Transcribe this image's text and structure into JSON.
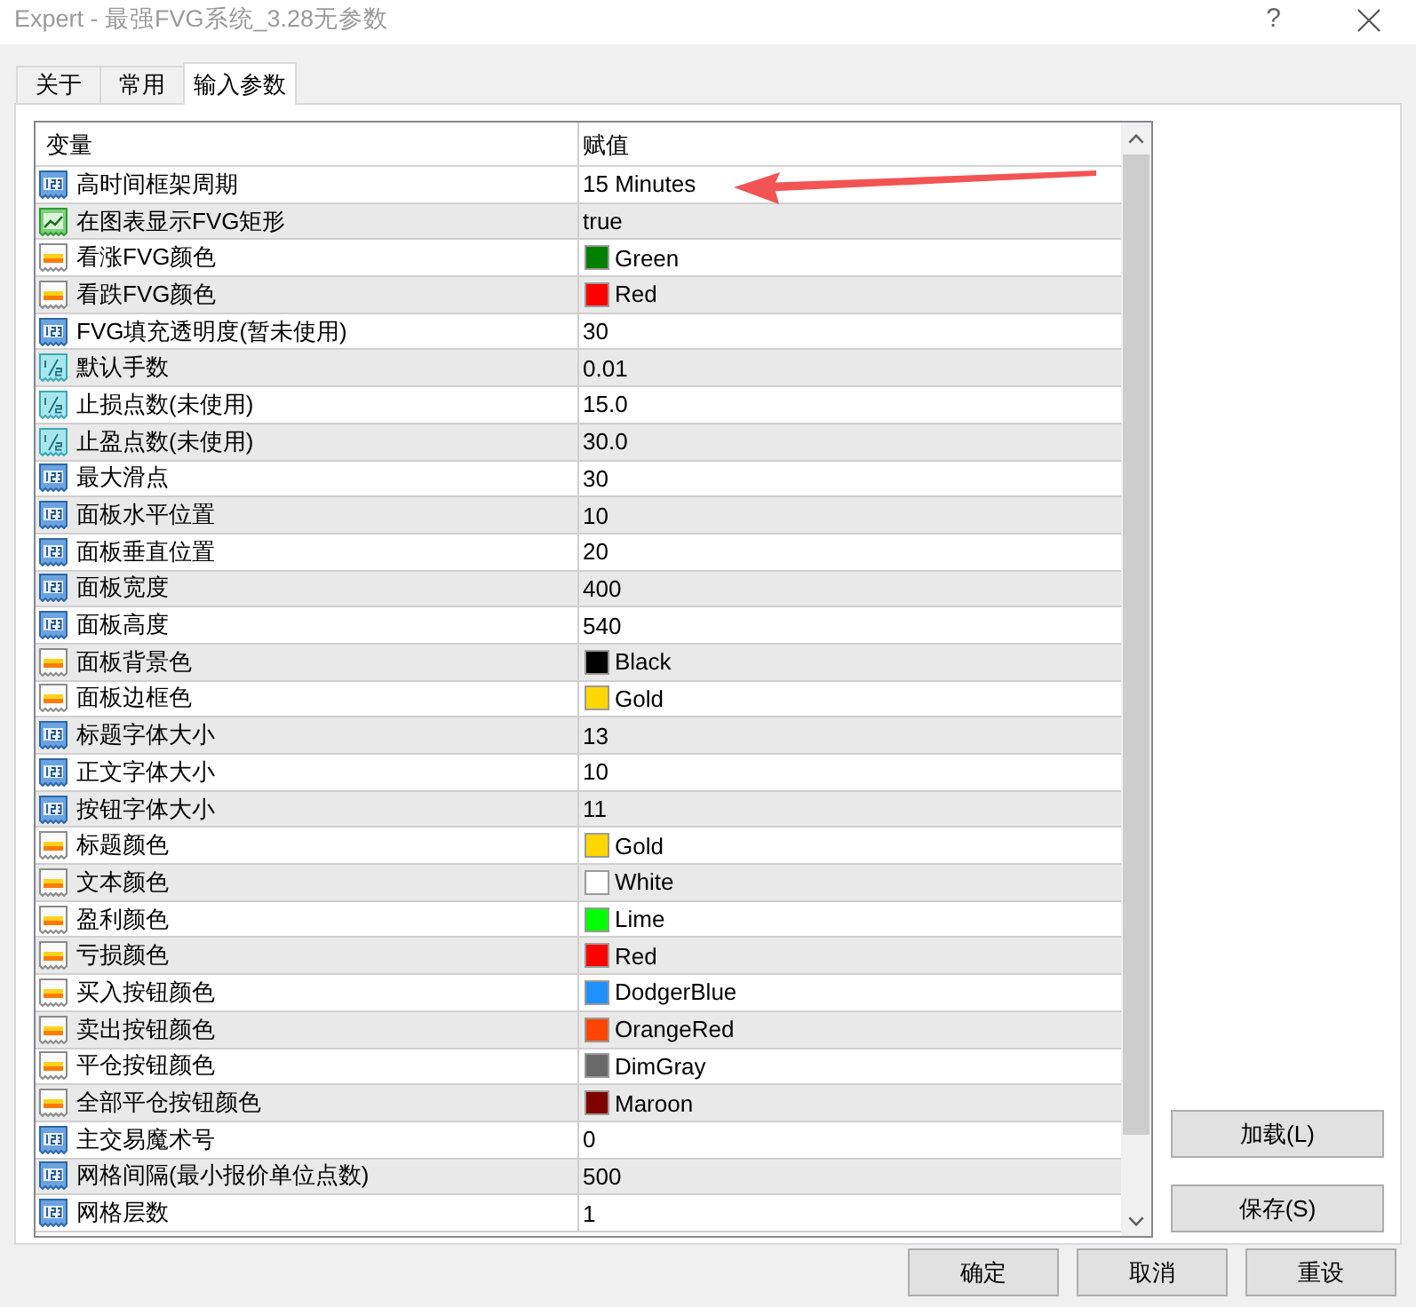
{
  "window": {
    "title": "Expert - 最强FVG系统_3.28无参数",
    "help": "?"
  },
  "tabs": [
    {
      "label": "关于",
      "selected": false
    },
    {
      "label": "常用",
      "selected": false
    },
    {
      "label": "输入参数",
      "selected": true
    }
  ],
  "table": {
    "columns": [
      "变量",
      "赋值"
    ],
    "rows": [
      {
        "kind": "int",
        "name": "高时间框架周期",
        "value": "15 Minutes"
      },
      {
        "kind": "bool",
        "name": "在图表显示FVG矩形",
        "value": "true"
      },
      {
        "kind": "color",
        "name": "看涨FVG颜色",
        "value": "Green",
        "color": "#008000"
      },
      {
        "kind": "color",
        "name": "看跌FVG颜色",
        "value": "Red",
        "color": "#ff0000"
      },
      {
        "kind": "int",
        "name": "FVG填充透明度(暂未使用)",
        "value": "30"
      },
      {
        "kind": "double",
        "name": "默认手数",
        "value": "0.01"
      },
      {
        "kind": "double",
        "name": "止损点数(未使用)",
        "value": "15.0"
      },
      {
        "kind": "double",
        "name": "止盈点数(未使用)",
        "value": "30.0"
      },
      {
        "kind": "int",
        "name": "最大滑点",
        "value": "30"
      },
      {
        "kind": "int",
        "name": "面板水平位置",
        "value": "10"
      },
      {
        "kind": "int",
        "name": "面板垂直位置",
        "value": "20"
      },
      {
        "kind": "int",
        "name": "面板宽度",
        "value": "400"
      },
      {
        "kind": "int",
        "name": "面板高度",
        "value": "540"
      },
      {
        "kind": "color",
        "name": "面板背景色",
        "value": "Black",
        "color": "#000000"
      },
      {
        "kind": "color",
        "name": "面板边框色",
        "value": "Gold",
        "color": "#ffd700"
      },
      {
        "kind": "int",
        "name": "标题字体大小",
        "value": "13"
      },
      {
        "kind": "int",
        "name": "正文字体大小",
        "value": "10"
      },
      {
        "kind": "int",
        "name": "按钮字体大小",
        "value": "11"
      },
      {
        "kind": "color",
        "name": "标题颜色",
        "value": "Gold",
        "color": "#ffd700"
      },
      {
        "kind": "color",
        "name": "文本颜色",
        "value": "White",
        "color": "#ffffff"
      },
      {
        "kind": "color",
        "name": "盈利颜色",
        "value": "Lime",
        "color": "#00ff00"
      },
      {
        "kind": "color",
        "name": "亏损颜色",
        "value": "Red",
        "color": "#ff0000"
      },
      {
        "kind": "color",
        "name": "买入按钮颜色",
        "value": "DodgerBlue",
        "color": "#1e90ff"
      },
      {
        "kind": "color",
        "name": "卖出按钮颜色",
        "value": "OrangeRed",
        "color": "#ff4500"
      },
      {
        "kind": "color",
        "name": "平仓按钮颜色",
        "value": "DimGray",
        "color": "#696969"
      },
      {
        "kind": "color",
        "name": "全部平仓按钮颜色",
        "value": "Maroon",
        "color": "#800000"
      },
      {
        "kind": "int",
        "name": "主交易魔术号",
        "value": "0"
      },
      {
        "kind": "int",
        "name": "网格间隔(最小报价单位点数)",
        "value": "500"
      },
      {
        "kind": "int",
        "name": "网格层数",
        "value": "1"
      }
    ]
  },
  "annotations": [
    {
      "kind": "arrow"
    }
  ],
  "side_buttons": [
    "加载(L)",
    "保存(S)"
  ],
  "buttons": [
    "确定",
    "取消",
    "重设"
  ]
}
